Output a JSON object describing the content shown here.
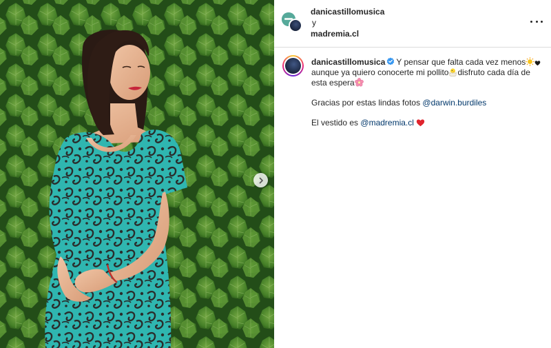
{
  "post": {
    "collaborators": {
      "user1": "danicastillomusica",
      "joiner": "y",
      "user2": "madremia.cl"
    },
    "more_icon": "more-horizontal-icon",
    "next_icon": "chevron-right-icon",
    "caption": {
      "username": "danicastillomusica",
      "verified_icon": "verified-badge-icon",
      "line1_a": "Y pensar que falta cada vez menos",
      "emoji1": "sun-emoji",
      "emoji2": "black-heart-emoji",
      "line1_b": "aunque ya quiero conocerte mi pollito",
      "emoji3": "hatching-chick-emoji",
      "line1_c": "disfruto cada día de esta espera",
      "emoji4": "cherry-blossom-emoji",
      "line2_text": "Gracias por estas lindas fotos",
      "line2_mention": "@darwin.burdiles",
      "line3_text": "El vestido es",
      "line3_mention": "@madremia.cl",
      "emoji5": "red-heart-emoji"
    }
  },
  "colors": {
    "mention": "#00376b",
    "text": "#262626",
    "divider": "#dbdbdb",
    "dress_teal": "#2fb6b0",
    "dress_dark": "#2a2d2c",
    "foliage": "#4f8a2e"
  }
}
